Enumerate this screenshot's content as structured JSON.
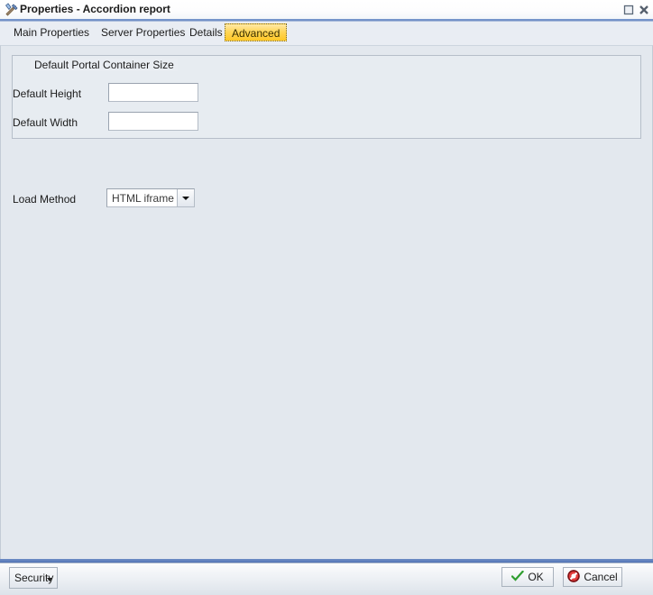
{
  "window": {
    "title": "Properties - Accordion report",
    "icon": "tools-icon",
    "controls": {
      "maximize": "maximize-restore",
      "close": "close"
    }
  },
  "tabs": [
    {
      "label": "Main Properties",
      "active": false
    },
    {
      "label": "Server Properties",
      "active": false
    },
    {
      "label": "Details",
      "active": false
    },
    {
      "label": "Advanced",
      "active": true
    }
  ],
  "group": {
    "legend": "Default Portal Container Size",
    "fields": [
      {
        "label": "Default Height",
        "value": "",
        "placeholder": ""
      },
      {
        "label": "Default Width",
        "value": "",
        "placeholder": ""
      }
    ]
  },
  "load_method": {
    "label": "Load Method",
    "value": "HTML iframe"
  },
  "footer": {
    "security_label": "Security",
    "ok_label": "OK",
    "cancel_label": "Cancel"
  },
  "colors": {
    "accent_blue": "#5f80bd",
    "active_tab_gold": "#ffd659",
    "panel_bg": "#e3e8ee",
    "ok_green": "#2f9e2f",
    "cancel_red": "#c0262a"
  }
}
